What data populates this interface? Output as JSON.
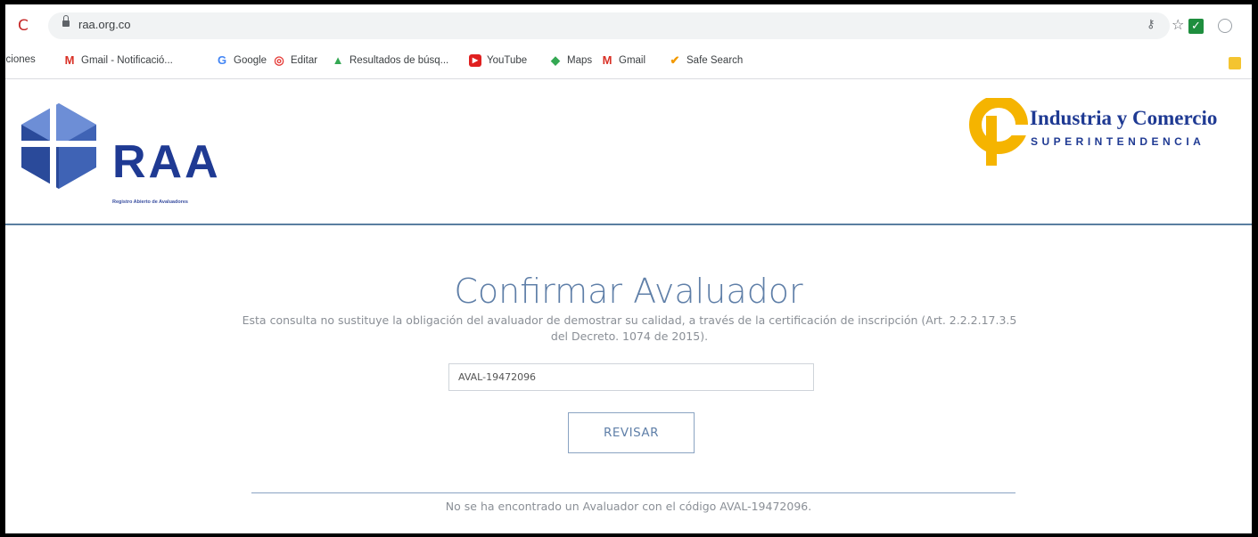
{
  "browser": {
    "url": "raa.org.co",
    "icons": [
      "reload-icon",
      "lock-icon",
      "key-icon",
      "star-icon",
      "extension-check-icon",
      "extension-circle-icon"
    ]
  },
  "bookmarks": [
    {
      "label": "iciones",
      "icon": ""
    },
    {
      "label": "Gmail - Notificació...",
      "icon": "gmail-icon"
    },
    {
      "label": "Google",
      "icon": "google-icon"
    },
    {
      "label": "Editar",
      "icon": "editar-icon"
    },
    {
      "label": "Resultados de búsq...",
      "icon": "drive-icon"
    },
    {
      "label": "YouTube",
      "icon": "youtube-icon"
    },
    {
      "label": "Maps",
      "icon": "maps-icon"
    },
    {
      "label": "Gmail",
      "icon": "gmail-icon"
    },
    {
      "label": "Safe Search",
      "icon": "safe-search-icon"
    }
  ],
  "header": {
    "logo_text": "RAA",
    "logo_subtitle": "Registro Abierto de Avaluadores",
    "sic_title": "Industria y Comercio",
    "sic_subtitle": "SUPERINTENDENCIA"
  },
  "main": {
    "title": "Confirmar Avaluador",
    "disclaimer": "Esta consulta no sustituye la obligación del avaluador de demostrar su calidad, a través de la certificación de inscripción (Art. 2.2.2.17.3.5 del Decreto. 1074 de 2015).",
    "input_value": "AVAL-19472096",
    "button_label": "REVISAR",
    "result_message": "No se ha encontrado un Avaluador con el código AVAL-19472096."
  },
  "colors": {
    "brand_blue": "#1f3a93",
    "accent": "#5f7fa8",
    "sic_yellow": "#f5b400"
  }
}
